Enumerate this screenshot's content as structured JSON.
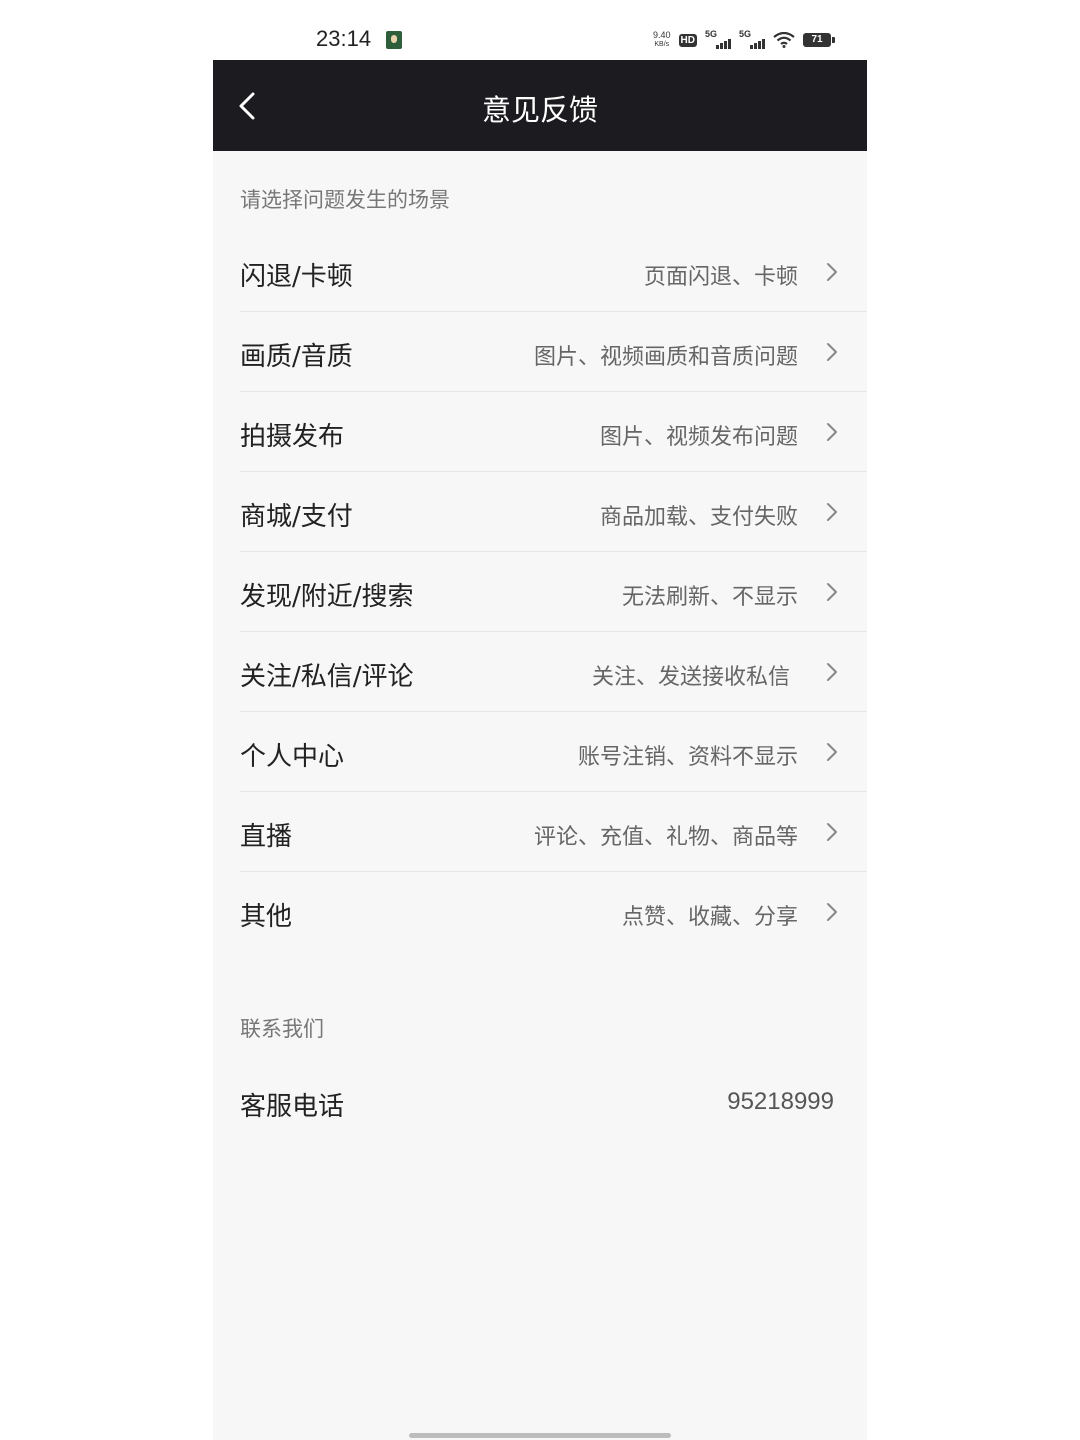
{
  "status_bar": {
    "time": "23:14",
    "net_speed_value": "9.40",
    "net_speed_unit": "KB/s",
    "hd_label": "HD",
    "signal1_label": "5G",
    "signal2_label": "5G",
    "battery": "71",
    "icons": [
      "notification-app-icon",
      "hd-voice-icon",
      "signal-5g-icon",
      "signal-5g-icon",
      "wifi-icon",
      "battery-icon"
    ]
  },
  "header": {
    "title": "意见反馈",
    "back_icon": "chevron-left-icon"
  },
  "scenes": {
    "section_label": "请选择问题发生的场景",
    "items": [
      {
        "title": "闪退/卡顿",
        "desc": "页面闪退、卡顿"
      },
      {
        "title": "画质/音质",
        "desc": "图片、视频画质和音质问题"
      },
      {
        "title": "拍摄发布",
        "desc": "图片、视频发布问题"
      },
      {
        "title": "商城/支付",
        "desc": "商品加载、支付失败"
      },
      {
        "title": "发现/附近/搜索",
        "desc": "无法刷新、不显示"
      },
      {
        "title": "关注/私信/评论",
        "desc": "关注、发送接收私信"
      },
      {
        "title": "个人中心",
        "desc": "账号注销、资料不显示"
      },
      {
        "title": "直播",
        "desc": "评论、充值、礼物、商品等"
      },
      {
        "title": "其他",
        "desc": "点赞、收藏、分享"
      }
    ]
  },
  "contact": {
    "section_label": "联系我们",
    "service_label": "客服电话",
    "service_number": "95218999"
  },
  "colors": {
    "header_bg": "#1c1c20",
    "page_bg": "#f7f7f7",
    "text_primary": "#222222",
    "text_secondary": "#666666"
  }
}
